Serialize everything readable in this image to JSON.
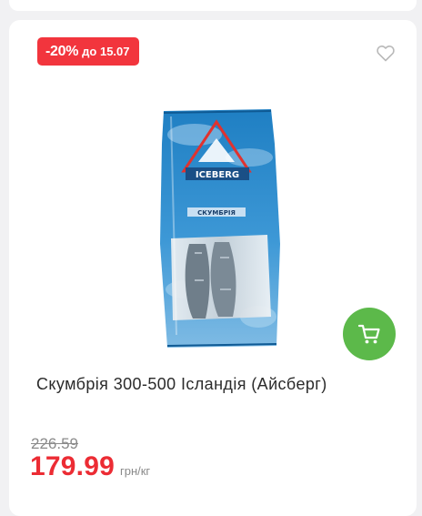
{
  "product": {
    "discount": "-20%",
    "discount_until": "до 15.07",
    "name": "Скумбрія 300-500 Ісландія (Айсберг)",
    "old_price": "226.59",
    "price": "179.99",
    "unit": "грн/кг",
    "package_brand": "ICEBERG",
    "package_label": "СКУМБРІЯ"
  },
  "colors": {
    "discount_badge": "#f2353d",
    "price": "#ec2c34",
    "cart_button": "#5cb94a"
  },
  "icons": {
    "favorite": "heart-outline-icon",
    "cart": "shopping-cart-icon"
  }
}
